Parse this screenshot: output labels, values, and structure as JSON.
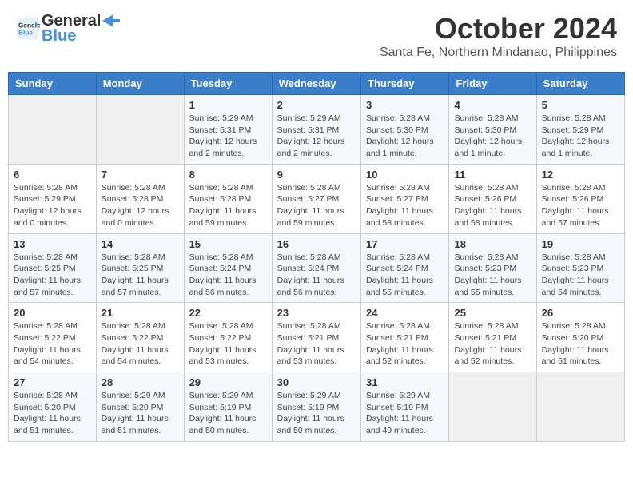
{
  "header": {
    "logo_line1": "General",
    "logo_line2": "Blue",
    "month": "October 2024",
    "location": "Santa Fe, Northern Mindanao, Philippines"
  },
  "days_of_week": [
    "Sunday",
    "Monday",
    "Tuesday",
    "Wednesday",
    "Thursday",
    "Friday",
    "Saturday"
  ],
  "weeks": [
    [
      {
        "day": "",
        "info": ""
      },
      {
        "day": "",
        "info": ""
      },
      {
        "day": "1",
        "info": "Sunrise: 5:29 AM\nSunset: 5:31 PM\nDaylight: 12 hours and 2 minutes."
      },
      {
        "day": "2",
        "info": "Sunrise: 5:29 AM\nSunset: 5:31 PM\nDaylight: 12 hours and 2 minutes."
      },
      {
        "day": "3",
        "info": "Sunrise: 5:28 AM\nSunset: 5:30 PM\nDaylight: 12 hours and 1 minute."
      },
      {
        "day": "4",
        "info": "Sunrise: 5:28 AM\nSunset: 5:30 PM\nDaylight: 12 hours and 1 minute."
      },
      {
        "day": "5",
        "info": "Sunrise: 5:28 AM\nSunset: 5:29 PM\nDaylight: 12 hours and 1 minute."
      }
    ],
    [
      {
        "day": "6",
        "info": "Sunrise: 5:28 AM\nSunset: 5:29 PM\nDaylight: 12 hours and 0 minutes."
      },
      {
        "day": "7",
        "info": "Sunrise: 5:28 AM\nSunset: 5:28 PM\nDaylight: 12 hours and 0 minutes."
      },
      {
        "day": "8",
        "info": "Sunrise: 5:28 AM\nSunset: 5:28 PM\nDaylight: 11 hours and 59 minutes."
      },
      {
        "day": "9",
        "info": "Sunrise: 5:28 AM\nSunset: 5:27 PM\nDaylight: 11 hours and 59 minutes."
      },
      {
        "day": "10",
        "info": "Sunrise: 5:28 AM\nSunset: 5:27 PM\nDaylight: 11 hours and 58 minutes."
      },
      {
        "day": "11",
        "info": "Sunrise: 5:28 AM\nSunset: 5:26 PM\nDaylight: 11 hours and 58 minutes."
      },
      {
        "day": "12",
        "info": "Sunrise: 5:28 AM\nSunset: 5:26 PM\nDaylight: 11 hours and 57 minutes."
      }
    ],
    [
      {
        "day": "13",
        "info": "Sunrise: 5:28 AM\nSunset: 5:25 PM\nDaylight: 11 hours and 57 minutes."
      },
      {
        "day": "14",
        "info": "Sunrise: 5:28 AM\nSunset: 5:25 PM\nDaylight: 11 hours and 57 minutes."
      },
      {
        "day": "15",
        "info": "Sunrise: 5:28 AM\nSunset: 5:24 PM\nDaylight: 11 hours and 56 minutes."
      },
      {
        "day": "16",
        "info": "Sunrise: 5:28 AM\nSunset: 5:24 PM\nDaylight: 11 hours and 56 minutes."
      },
      {
        "day": "17",
        "info": "Sunrise: 5:28 AM\nSunset: 5:24 PM\nDaylight: 11 hours and 55 minutes."
      },
      {
        "day": "18",
        "info": "Sunrise: 5:28 AM\nSunset: 5:23 PM\nDaylight: 11 hours and 55 minutes."
      },
      {
        "day": "19",
        "info": "Sunrise: 5:28 AM\nSunset: 5:23 PM\nDaylight: 11 hours and 54 minutes."
      }
    ],
    [
      {
        "day": "20",
        "info": "Sunrise: 5:28 AM\nSunset: 5:22 PM\nDaylight: 11 hours and 54 minutes."
      },
      {
        "day": "21",
        "info": "Sunrise: 5:28 AM\nSunset: 5:22 PM\nDaylight: 11 hours and 54 minutes."
      },
      {
        "day": "22",
        "info": "Sunrise: 5:28 AM\nSunset: 5:22 PM\nDaylight: 11 hours and 53 minutes."
      },
      {
        "day": "23",
        "info": "Sunrise: 5:28 AM\nSunset: 5:21 PM\nDaylight: 11 hours and 53 minutes."
      },
      {
        "day": "24",
        "info": "Sunrise: 5:28 AM\nSunset: 5:21 PM\nDaylight: 11 hours and 52 minutes."
      },
      {
        "day": "25",
        "info": "Sunrise: 5:28 AM\nSunset: 5:21 PM\nDaylight: 11 hours and 52 minutes."
      },
      {
        "day": "26",
        "info": "Sunrise: 5:28 AM\nSunset: 5:20 PM\nDaylight: 11 hours and 51 minutes."
      }
    ],
    [
      {
        "day": "27",
        "info": "Sunrise: 5:28 AM\nSunset: 5:20 PM\nDaylight: 11 hours and 51 minutes."
      },
      {
        "day": "28",
        "info": "Sunrise: 5:29 AM\nSunset: 5:20 PM\nDaylight: 11 hours and 51 minutes."
      },
      {
        "day": "29",
        "info": "Sunrise: 5:29 AM\nSunset: 5:19 PM\nDaylight: 11 hours and 50 minutes."
      },
      {
        "day": "30",
        "info": "Sunrise: 5:29 AM\nSunset: 5:19 PM\nDaylight: 11 hours and 50 minutes."
      },
      {
        "day": "31",
        "info": "Sunrise: 5:29 AM\nSunset: 5:19 PM\nDaylight: 11 hours and 49 minutes."
      },
      {
        "day": "",
        "info": ""
      },
      {
        "day": "",
        "info": ""
      }
    ]
  ]
}
